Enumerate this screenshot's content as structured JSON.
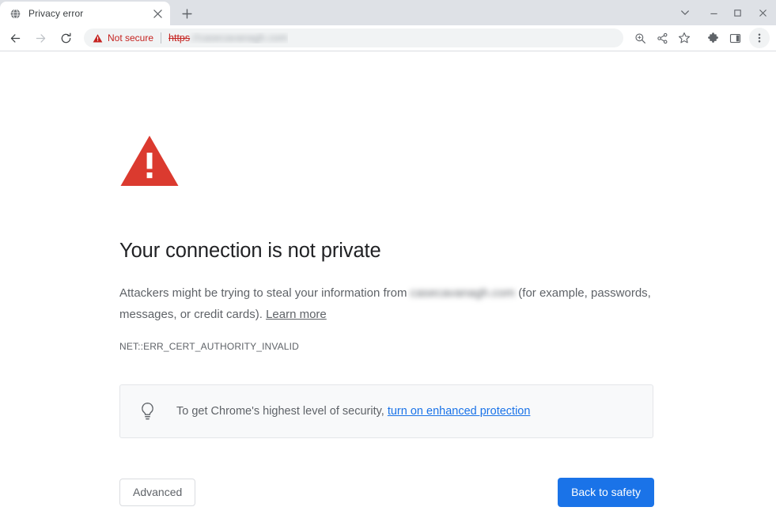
{
  "window": {
    "controls": [
      {
        "name": "tab-search-button",
        "icon": "chevron-down-icon",
        "label": "Search tabs"
      },
      {
        "name": "minimize-button",
        "icon": "minimize-icon",
        "label": "Minimize"
      },
      {
        "name": "maximize-button",
        "icon": "maximize-icon",
        "label": "Maximize"
      },
      {
        "name": "close-window-button",
        "icon": "close-icon",
        "label": "Close"
      }
    ]
  },
  "tabstrip": {
    "tab": {
      "title": "Privacy error",
      "favicon": "globe-icon",
      "close_label": "Close tab"
    },
    "new_tab_label": "New tab"
  },
  "toolbar": {
    "back_label": "Back",
    "forward_label": "Forward",
    "reload_label": "Reload",
    "omnibox": {
      "security_status": "Not secure",
      "security_icon": "warning-triangle-icon",
      "url_scheme": "https",
      "url_rest": "://casecavanagh.com"
    },
    "actions": [
      {
        "name": "zoom-icon",
        "label": "Zoom"
      },
      {
        "name": "share-icon",
        "label": "Share this page"
      },
      {
        "name": "bookmark-star-icon",
        "label": "Bookmark this tab"
      },
      {
        "name": "extensions-icon",
        "label": "Extensions"
      },
      {
        "name": "side-panel-icon",
        "label": "Side panel"
      },
      {
        "name": "three-dot-menu-icon",
        "label": "Customize and control Google Chrome"
      }
    ]
  },
  "interstitial": {
    "icon": "red-warning-triangle",
    "icon_color": "#db3a2f",
    "title": "Your connection is not private",
    "body_prefix": "Attackers might be trying to steal your information from ",
    "body_host": "casecavanagh.com",
    "body_middle": " (for example, passwords, messages, or credit cards). ",
    "learn_more": "Learn more",
    "error_code": "NET::ERR_CERT_AUTHORITY_INVALID",
    "enhanced": {
      "icon": "lightbulb-icon",
      "text": "To get Chrome's highest level of security, ",
      "link": "turn on enhanced protection"
    },
    "advanced_button": "Advanced",
    "safety_button": "Back to safety",
    "accent_color": "#1a73e8"
  }
}
